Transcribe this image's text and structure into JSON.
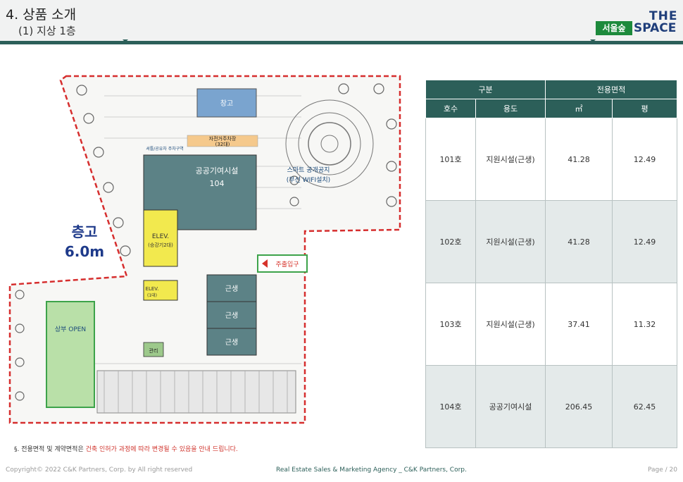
{
  "header": {
    "title": "4. 상품 소개",
    "subtitle": "(1) 지상 1층"
  },
  "logo": {
    "badge": "서울숲",
    "the": "THE",
    "space": "SPACE"
  },
  "plan": {
    "labels": {
      "storage": "창고",
      "parking": "자전거주차장",
      "parking_count": "(32대)",
      "shuttle": "셔틀/공유차 주차구역",
      "public": "공공기여시설",
      "public_no": "104",
      "wifi1": "스마트 공개공지",
      "wifi2": "(무선 WIFI설치)",
      "elev": "ELEV.",
      "elev_sub": "(승강기2대)",
      "elev2": "ELEV.",
      "elev2_sub": "(1대)",
      "main_entry": "주출입구",
      "unit": "근생",
      "retail_open": "상부 OPEN",
      "height_title": "층고",
      "height_value": "6.0m",
      "room": "관리"
    }
  },
  "table": {
    "head1": [
      "구분",
      "전용면적"
    ],
    "head2": [
      "호수",
      "용도",
      "㎡",
      "평"
    ],
    "rows": [
      [
        "101호",
        "지원시설(근생)",
        "41.28",
        "12.49"
      ],
      [
        "102호",
        "지원시설(근생)",
        "41.28",
        "12.49"
      ],
      [
        "103호",
        "지원시설(근생)",
        "37.41",
        "11.32"
      ],
      [
        "104호",
        "공공기여시설",
        "206.45",
        "62.45"
      ]
    ]
  },
  "note": {
    "prefix": "§. 전용면적 및 계약면적은 ",
    "red": "건축 인허가 과정에 따라 변경될 수 있음을 안내 드립니다."
  },
  "footer": {
    "copyright": "Copyright© 2022 C&K Partners, Corp. by  All right reserved",
    "agency": "Real Estate Sales & Marketing Agency _ C&K Partners, Corp.",
    "page": "Page / 20"
  },
  "colors": {
    "accent": "#2c5f59",
    "red": "#d0352e",
    "brand_green": "#1d8a3c",
    "brand_blue": "#1f3e7a"
  }
}
